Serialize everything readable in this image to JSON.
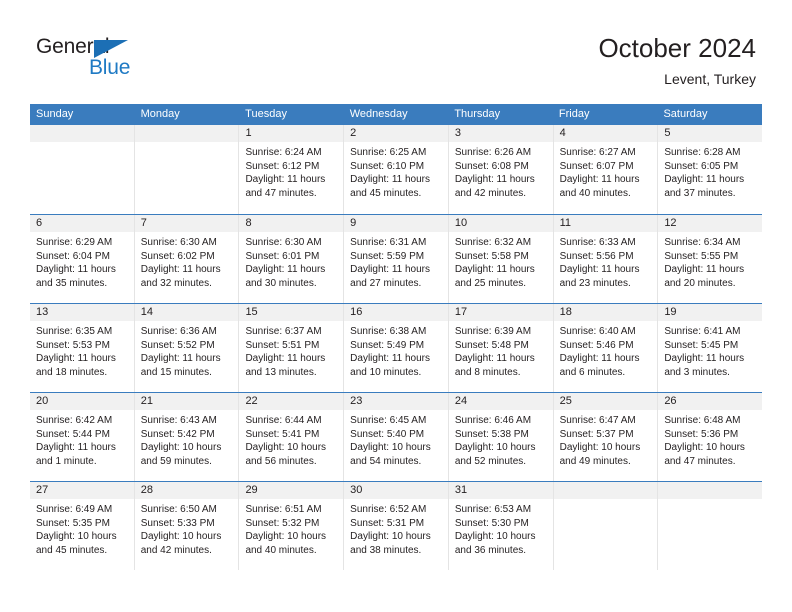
{
  "brand": {
    "name_top": "General",
    "name_bottom": "Blue",
    "accent_color": "#1c6fb5",
    "triangle_icon": "brand-triangle-icon"
  },
  "header": {
    "title": "October 2024",
    "subtitle": "Levent, Turkey"
  },
  "colors": {
    "header_blue": "#3a7cbe",
    "day_band_gray": "#f1f1f1",
    "text": "#231f20",
    "cell_divider": "#e4e4e4"
  },
  "weekdays": [
    "Sunday",
    "Monday",
    "Tuesday",
    "Wednesday",
    "Thursday",
    "Friday",
    "Saturday"
  ],
  "weeks": [
    [
      {
        "day": "",
        "empty": true
      },
      {
        "day": "",
        "empty": true
      },
      {
        "day": "1",
        "sunrise": "Sunrise: 6:24 AM",
        "sunset": "Sunset: 6:12 PM",
        "daylight_1": "Daylight: 11 hours",
        "daylight_2": "and 47 minutes."
      },
      {
        "day": "2",
        "sunrise": "Sunrise: 6:25 AM",
        "sunset": "Sunset: 6:10 PM",
        "daylight_1": "Daylight: 11 hours",
        "daylight_2": "and 45 minutes."
      },
      {
        "day": "3",
        "sunrise": "Sunrise: 6:26 AM",
        "sunset": "Sunset: 6:08 PM",
        "daylight_1": "Daylight: 11 hours",
        "daylight_2": "and 42 minutes."
      },
      {
        "day": "4",
        "sunrise": "Sunrise: 6:27 AM",
        "sunset": "Sunset: 6:07 PM",
        "daylight_1": "Daylight: 11 hours",
        "daylight_2": "and 40 minutes."
      },
      {
        "day": "5",
        "sunrise": "Sunrise: 6:28 AM",
        "sunset": "Sunset: 6:05 PM",
        "daylight_1": "Daylight: 11 hours",
        "daylight_2": "and 37 minutes."
      }
    ],
    [
      {
        "day": "6",
        "sunrise": "Sunrise: 6:29 AM",
        "sunset": "Sunset: 6:04 PM",
        "daylight_1": "Daylight: 11 hours",
        "daylight_2": "and 35 minutes."
      },
      {
        "day": "7",
        "sunrise": "Sunrise: 6:30 AM",
        "sunset": "Sunset: 6:02 PM",
        "daylight_1": "Daylight: 11 hours",
        "daylight_2": "and 32 minutes."
      },
      {
        "day": "8",
        "sunrise": "Sunrise: 6:30 AM",
        "sunset": "Sunset: 6:01 PM",
        "daylight_1": "Daylight: 11 hours",
        "daylight_2": "and 30 minutes."
      },
      {
        "day": "9",
        "sunrise": "Sunrise: 6:31 AM",
        "sunset": "Sunset: 5:59 PM",
        "daylight_1": "Daylight: 11 hours",
        "daylight_2": "and 27 minutes."
      },
      {
        "day": "10",
        "sunrise": "Sunrise: 6:32 AM",
        "sunset": "Sunset: 5:58 PM",
        "daylight_1": "Daylight: 11 hours",
        "daylight_2": "and 25 minutes."
      },
      {
        "day": "11",
        "sunrise": "Sunrise: 6:33 AM",
        "sunset": "Sunset: 5:56 PM",
        "daylight_1": "Daylight: 11 hours",
        "daylight_2": "and 23 minutes."
      },
      {
        "day": "12",
        "sunrise": "Sunrise: 6:34 AM",
        "sunset": "Sunset: 5:55 PM",
        "daylight_1": "Daylight: 11 hours",
        "daylight_2": "and 20 minutes."
      }
    ],
    [
      {
        "day": "13",
        "sunrise": "Sunrise: 6:35 AM",
        "sunset": "Sunset: 5:53 PM",
        "daylight_1": "Daylight: 11 hours",
        "daylight_2": "and 18 minutes."
      },
      {
        "day": "14",
        "sunrise": "Sunrise: 6:36 AM",
        "sunset": "Sunset: 5:52 PM",
        "daylight_1": "Daylight: 11 hours",
        "daylight_2": "and 15 minutes."
      },
      {
        "day": "15",
        "sunrise": "Sunrise: 6:37 AM",
        "sunset": "Sunset: 5:51 PM",
        "daylight_1": "Daylight: 11 hours",
        "daylight_2": "and 13 minutes."
      },
      {
        "day": "16",
        "sunrise": "Sunrise: 6:38 AM",
        "sunset": "Sunset: 5:49 PM",
        "daylight_1": "Daylight: 11 hours",
        "daylight_2": "and 10 minutes."
      },
      {
        "day": "17",
        "sunrise": "Sunrise: 6:39 AM",
        "sunset": "Sunset: 5:48 PM",
        "daylight_1": "Daylight: 11 hours",
        "daylight_2": "and 8 minutes."
      },
      {
        "day": "18",
        "sunrise": "Sunrise: 6:40 AM",
        "sunset": "Sunset: 5:46 PM",
        "daylight_1": "Daylight: 11 hours",
        "daylight_2": "and 6 minutes."
      },
      {
        "day": "19",
        "sunrise": "Sunrise: 6:41 AM",
        "sunset": "Sunset: 5:45 PM",
        "daylight_1": "Daylight: 11 hours",
        "daylight_2": "and 3 minutes."
      }
    ],
    [
      {
        "day": "20",
        "sunrise": "Sunrise: 6:42 AM",
        "sunset": "Sunset: 5:44 PM",
        "daylight_1": "Daylight: 11 hours",
        "daylight_2": "and 1 minute."
      },
      {
        "day": "21",
        "sunrise": "Sunrise: 6:43 AM",
        "sunset": "Sunset: 5:42 PM",
        "daylight_1": "Daylight: 10 hours",
        "daylight_2": "and 59 minutes."
      },
      {
        "day": "22",
        "sunrise": "Sunrise: 6:44 AM",
        "sunset": "Sunset: 5:41 PM",
        "daylight_1": "Daylight: 10 hours",
        "daylight_2": "and 56 minutes."
      },
      {
        "day": "23",
        "sunrise": "Sunrise: 6:45 AM",
        "sunset": "Sunset: 5:40 PM",
        "daylight_1": "Daylight: 10 hours",
        "daylight_2": "and 54 minutes."
      },
      {
        "day": "24",
        "sunrise": "Sunrise: 6:46 AM",
        "sunset": "Sunset: 5:38 PM",
        "daylight_1": "Daylight: 10 hours",
        "daylight_2": "and 52 minutes."
      },
      {
        "day": "25",
        "sunrise": "Sunrise: 6:47 AM",
        "sunset": "Sunset: 5:37 PM",
        "daylight_1": "Daylight: 10 hours",
        "daylight_2": "and 49 minutes."
      },
      {
        "day": "26",
        "sunrise": "Sunrise: 6:48 AM",
        "sunset": "Sunset: 5:36 PM",
        "daylight_1": "Daylight: 10 hours",
        "daylight_2": "and 47 minutes."
      }
    ],
    [
      {
        "day": "27",
        "sunrise": "Sunrise: 6:49 AM",
        "sunset": "Sunset: 5:35 PM",
        "daylight_1": "Daylight: 10 hours",
        "daylight_2": "and 45 minutes."
      },
      {
        "day": "28",
        "sunrise": "Sunrise: 6:50 AM",
        "sunset": "Sunset: 5:33 PM",
        "daylight_1": "Daylight: 10 hours",
        "daylight_2": "and 42 minutes."
      },
      {
        "day": "29",
        "sunrise": "Sunrise: 6:51 AM",
        "sunset": "Sunset: 5:32 PM",
        "daylight_1": "Daylight: 10 hours",
        "daylight_2": "and 40 minutes."
      },
      {
        "day": "30",
        "sunrise": "Sunrise: 6:52 AM",
        "sunset": "Sunset: 5:31 PM",
        "daylight_1": "Daylight: 10 hours",
        "daylight_2": "and 38 minutes."
      },
      {
        "day": "31",
        "sunrise": "Sunrise: 6:53 AM",
        "sunset": "Sunset: 5:30 PM",
        "daylight_1": "Daylight: 10 hours",
        "daylight_2": "and 36 minutes."
      },
      {
        "day": "",
        "empty": true
      },
      {
        "day": "",
        "empty": true
      }
    ]
  ]
}
